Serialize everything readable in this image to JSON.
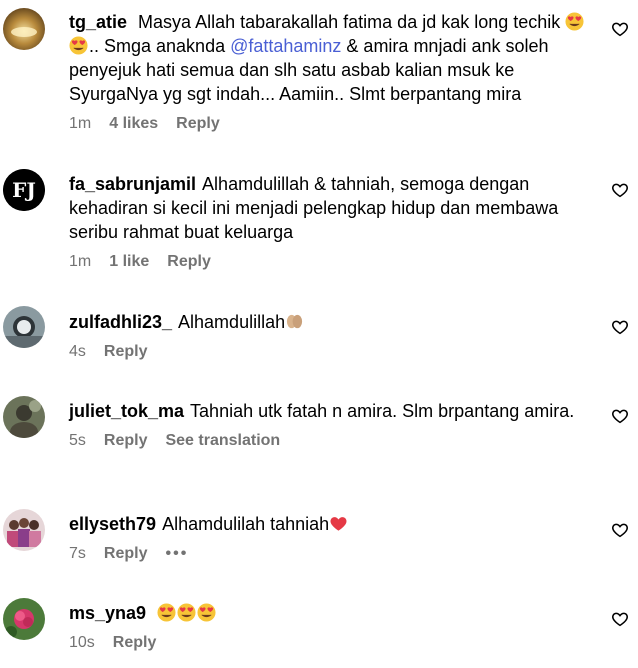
{
  "comments": [
    {
      "username": "tg_atie",
      "text_parts": [
        {
          "type": "text",
          "value": "Masya Allah tabarakallah fatima da jd kak long techik "
        },
        {
          "type": "emoji",
          "value": "heart-eyes"
        },
        {
          "type": "emoji",
          "value": "heart-eyes"
        },
        {
          "type": "text",
          "value": ".. Smga anaknda "
        },
        {
          "type": "mention",
          "value": "@fattahaminz"
        },
        {
          "type": "text",
          "value": " & amira mnjadi ank soleh penyejuk hati semua dan slh satu asbab kalian msuk ke SyurgaNya yg sgt indah... Aamiin.. Slmt berpantang mira"
        }
      ],
      "time": "1m",
      "likes": "4 likes",
      "reply": "Reply"
    },
    {
      "username": "fa_sabrunjamil",
      "text": "Alhamdulillah & tahniah, semoga dengan kehadiran si kecil ini menjadi pelengkap hidup dan membawa seribu rahmat buat keluarga",
      "avatar_text": "FJ",
      "time": "1m",
      "likes": "1 like",
      "reply": "Reply"
    },
    {
      "username": "zulfadhli23_",
      "text": "Alhamdulillah",
      "emoji": "folded-hands",
      "time": "4s",
      "reply": "Reply"
    },
    {
      "username": "juliet_tok_ma",
      "text": "Tahniah utk fatah n amira. Slm brpantang amira.",
      "time": "5s",
      "reply": "Reply",
      "translate": "See translation"
    },
    {
      "username": "ellyseth79",
      "text": "Alhamdulilah tahniah",
      "emoji": "red-heart",
      "time": "7s",
      "reply": "Reply",
      "more": "•••"
    },
    {
      "username": "ms_yna9",
      "emoji_count": 3,
      "emoji": "heart-eyes",
      "time": "10s",
      "reply": "Reply"
    }
  ],
  "icons": {
    "like": "heart-outline-icon"
  },
  "colors": {
    "muted": "#737373",
    "mention": "#4a5fd4"
  }
}
